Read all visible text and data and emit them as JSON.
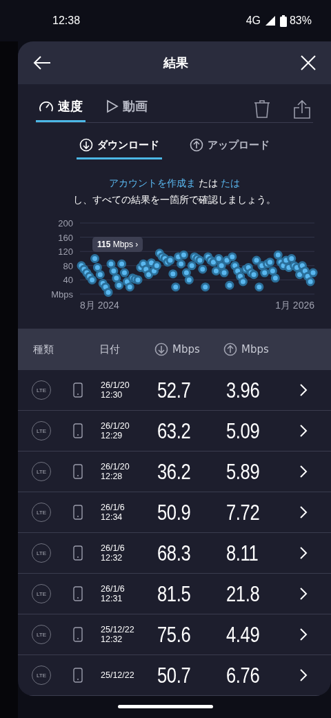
{
  "status_bar": {
    "time": "12:38",
    "network": "4G",
    "battery": "83%"
  },
  "header": {
    "title": "結果"
  },
  "tabs": [
    {
      "label": "速度",
      "selected": true
    },
    {
      "label": "動画",
      "selected": false
    }
  ],
  "subtabs": [
    {
      "label": "ダウンロード",
      "selected": true
    },
    {
      "label": "アップロード",
      "selected": false
    }
  ],
  "promo": {
    "lines": [
      [
        {
          "text": "アカウントを作成ま",
          "link": true
        },
        {
          "text": "たは",
          "link": false
        },
        {
          "text": "たは",
          "link": true
        }
      ],
      [
        {
          "text": "し、すべての結果を一箇所で確認しましょう。",
          "link": false
        }
      ]
    ]
  },
  "chart": {
    "tooltip": "**115** Mbps ›",
    "x_axis_labels": [
      "8月 2024",
      "1月 2026"
    ],
    "chart_data": {
      "type": "scatter",
      "grid": true,
      "ylim": [
        0,
        200
      ],
      "yticks": [
        {
          "value": 0,
          "label": "Mbps"
        },
        40,
        80,
        120,
        160,
        200
      ],
      "series": [
        {
          "color": "#5ab8f0",
          "values": [
            80,
            70,
            60,
            50,
            40,
            100,
            75,
            55,
            30,
            20,
            5,
            85,
            65,
            45,
            25,
            85,
            60,
            35,
            20,
            45,
            42,
            40,
            75,
            85,
            70,
            55,
            88,
            65,
            80,
            115,
            105,
            100,
            90,
            95,
            57,
            20,
            105,
            85,
            110,
            60,
            40,
            80,
            105,
            100,
            95,
            70,
            20,
            105,
            95,
            90,
            65,
            100,
            80,
            60,
            95,
            25,
            105,
            80,
            65,
            50,
            35,
            70,
            75,
            60,
            55,
            95,
            20,
            80,
            60,
            85,
            90,
            65,
            45,
            110,
            90,
            80,
            95,
            75,
            100,
            80,
            75,
            55,
            80,
            65,
            50,
            35,
            60
          ]
        }
      ]
    }
  },
  "table": {
    "columns": [
      "種類",
      "日付",
      "Mbps",
      "Mbps"
    ],
    "rows": [
      {
        "type": "LTE",
        "date": "26/1/20",
        "time": "12:30",
        "down": "52.7",
        "up": "3.96"
      },
      {
        "type": "LTE",
        "date": "26/1/20",
        "time": "12:29",
        "down": "63.2",
        "up": "5.09"
      },
      {
        "type": "LTE",
        "date": "26/1/20",
        "time": "12:28",
        "down": "36.2",
        "up": "5.89"
      },
      {
        "type": "LTE",
        "date": "26/1/6",
        "time": "12:34",
        "down": "50.9",
        "up": "7.72"
      },
      {
        "type": "LTE",
        "date": "26/1/6",
        "time": "12:32",
        "down": "68.3",
        "up": "8.11"
      },
      {
        "type": "LTE",
        "date": "26/1/6",
        "time": "12:31",
        "down": "81.5",
        "up": "21.8"
      },
      {
        "type": "LTE",
        "date": "25/12/22",
        "time": "12:32",
        "down": "75.6",
        "up": "4.49"
      },
      {
        "type": "LTE",
        "date": "25/12/22",
        "down": "50.7",
        "up": "6.76"
      }
    ]
  }
}
